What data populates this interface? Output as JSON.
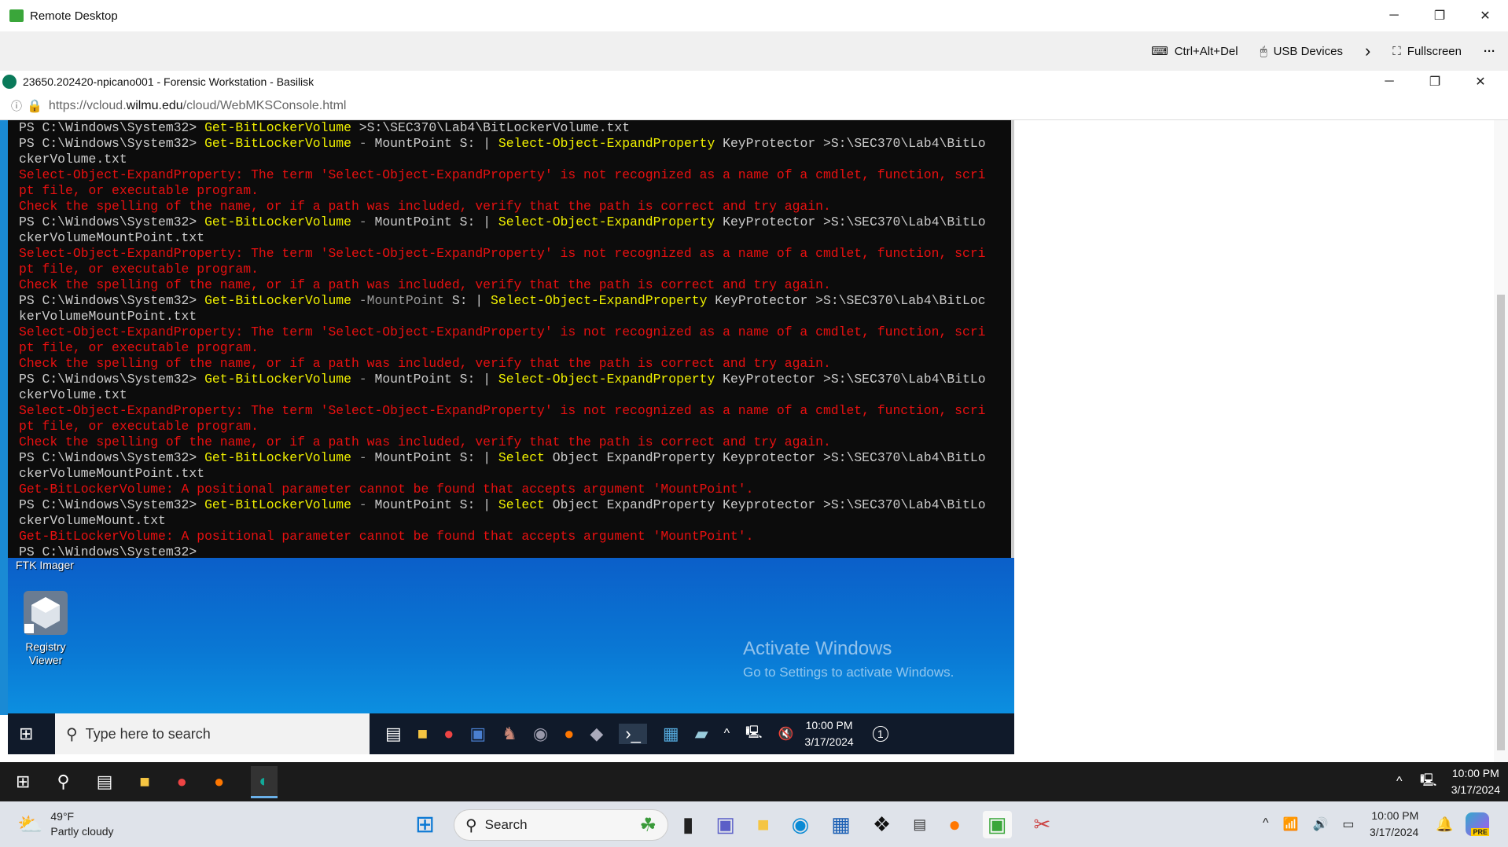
{
  "app": {
    "title": "Remote Desktop",
    "minimize": "─",
    "restore": "❐",
    "close": "✕"
  },
  "toolbar": {
    "ctrl_alt_del": "Ctrl+Alt+Del",
    "usb": "USB Devices",
    "chevron": "›",
    "fullscreen": "Fullscreen",
    "more": "···"
  },
  "inner_window": {
    "title": "23650.202420-npicano001 - Forensic Workstation - Basilisk",
    "url_prefix": "https://vcloud.",
    "url_domain": "wilmu.edu",
    "url_path": "/cloud/WebMKSConsole.html"
  },
  "console": {
    "lines": [
      [
        [
          "w",
          "PS C:\\Windows\\System32> "
        ],
        [
          "y",
          "Get-BitLockerVolume"
        ],
        [
          "w",
          " >S:\\SEC370\\Lab4\\BitLockerVolume.txt"
        ]
      ],
      [
        [
          "w",
          "PS C:\\Windows\\System32> "
        ],
        [
          "y",
          "Get-BitLockerVolume"
        ],
        [
          "g",
          " - "
        ],
        [
          "w",
          "MountPoint S: | "
        ],
        [
          "y",
          "Select-Object-ExpandProperty"
        ],
        [
          "w",
          " KeyProtector >S:\\SEC370\\Lab4\\BitLo"
        ]
      ],
      [
        [
          "w",
          "ckerVolume.txt"
        ]
      ],
      [
        [
          "r",
          "Select-Object-ExpandProperty: The term 'Select-Object-ExpandProperty' is not recognized as a name of a cmdlet, function, scri"
        ]
      ],
      [
        [
          "r",
          "pt file, or executable program."
        ]
      ],
      [
        [
          "r",
          "Check the spelling of the name, or if a path was included, verify that the path is correct and try again."
        ]
      ],
      [
        [
          "w",
          "PS C:\\Windows\\System32> "
        ],
        [
          "y",
          "Get-BitLockerVolume"
        ],
        [
          "g",
          " - "
        ],
        [
          "w",
          "MountPoint S: | "
        ],
        [
          "y",
          "Select-Object-ExpandProperty"
        ],
        [
          "w",
          " KeyProtector >S:\\SEC370\\Lab4\\BitLo"
        ]
      ],
      [
        [
          "w",
          "ckerVolumeMountPoint.txt"
        ]
      ],
      [
        [
          "r",
          "Select-Object-ExpandProperty: The term 'Select-Object-ExpandProperty' is not recognized as a name of a cmdlet, function, scri"
        ]
      ],
      [
        [
          "r",
          "pt file, or executable program."
        ]
      ],
      [
        [
          "r",
          "Check the spelling of the name, or if a path was included, verify that the path is correct and try again."
        ]
      ],
      [
        [
          "w",
          "PS C:\\Windows\\System32> "
        ],
        [
          "y",
          "Get-BitLockerVolume"
        ],
        [
          "g",
          " -MountPoint"
        ],
        [
          "w",
          " S: | "
        ],
        [
          "y",
          "Select-Object-ExpandProperty"
        ],
        [
          "w",
          " KeyProtector >S:\\SEC370\\Lab4\\BitLoc"
        ]
      ],
      [
        [
          "w",
          "kerVolumeMountPoint.txt"
        ]
      ],
      [
        [
          "r",
          "Select-Object-ExpandProperty: The term 'Select-Object-ExpandProperty' is not recognized as a name of a cmdlet, function, scri"
        ]
      ],
      [
        [
          "r",
          "pt file, or executable program."
        ]
      ],
      [
        [
          "r",
          "Check the spelling of the name, or if a path was included, verify that the path is correct and try again."
        ]
      ],
      [
        [
          "w",
          "PS C:\\Windows\\System32> "
        ],
        [
          "y",
          "Get-BitLockerVolume"
        ],
        [
          "g",
          " - "
        ],
        [
          "w",
          "MountPoint S: | "
        ],
        [
          "y",
          "Select-Object-ExpandProperty"
        ],
        [
          "w",
          " KeyProtector >S:\\SEC370\\Lab4\\BitLo"
        ]
      ],
      [
        [
          "w",
          "ckerVolume.txt"
        ]
      ],
      [
        [
          "r",
          "Select-Object-ExpandProperty: The term 'Select-Object-ExpandProperty' is not recognized as a name of a cmdlet, function, scri"
        ]
      ],
      [
        [
          "r",
          "pt file, or executable program."
        ]
      ],
      [
        [
          "r",
          "Check the spelling of the name, or if a path was included, verify that the path is correct and try again."
        ]
      ],
      [
        [
          "w",
          "PS C:\\Windows\\System32> "
        ],
        [
          "y",
          "Get-BitLockerVolume"
        ],
        [
          "g",
          " - "
        ],
        [
          "w",
          "MountPoint S: | "
        ],
        [
          "y",
          "Select"
        ],
        [
          "w",
          " Object ExpandProperty Keyprotector >S:\\SEC370\\Lab4\\BitLo"
        ]
      ],
      [
        [
          "w",
          "ckerVolumeMountPoint.txt"
        ]
      ],
      [
        [
          "r",
          "Get-BitLockerVolume: A positional parameter cannot be found that accepts argument 'MountPoint'."
        ]
      ],
      [
        [
          "w",
          "PS C:\\Windows\\System32> "
        ],
        [
          "y",
          "Get-BitLockerVolume"
        ],
        [
          "g",
          " - "
        ],
        [
          "w",
          "MountPoint S: | "
        ],
        [
          "y",
          "Select"
        ],
        [
          "w",
          " Object ExpandProperty Keyprotector >S:\\SEC370\\Lab4\\BitLo"
        ]
      ],
      [
        [
          "w",
          "ckerVolumeMount.txt"
        ]
      ],
      [
        [
          "r",
          "Get-BitLockerVolume: A positional parameter cannot be found that accepts argument 'MountPoint'."
        ]
      ],
      [
        [
          "w",
          "PS C:\\Windows\\System32>"
        ]
      ]
    ],
    "colors": {
      "w": "#cccccc",
      "y": "#f0f000",
      "r": "#e81010",
      "g": "#9a9a9a"
    }
  },
  "desktop": {
    "ftk_label": "FTK Imager",
    "registry_label": "Registry Viewer",
    "activate_title": "Activate Windows",
    "activate_sub": "Go to Settings to activate Windows."
  },
  "inner_taskbar": {
    "search_placeholder": "Type here to search",
    "time": "10:00 PM",
    "date": "3/17/2024",
    "notif_count": "1"
  },
  "remote_taskbar": {
    "time": "10:00 PM",
    "date": "3/17/2024"
  },
  "win_taskbar": {
    "temp": "49°F",
    "weather": "Partly cloudy",
    "search": "Search",
    "time": "10:00 PM",
    "date": "3/17/2024",
    "copilot_badge": "PRE"
  }
}
